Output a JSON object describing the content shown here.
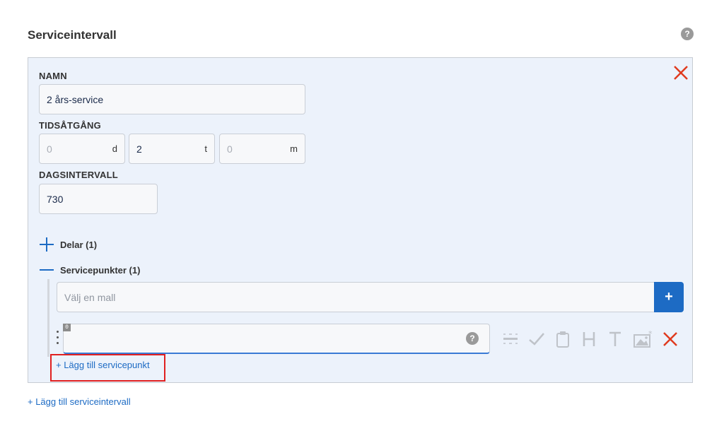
{
  "section": {
    "title": "Serviceintervall",
    "help_icon": "?"
  },
  "form": {
    "name": {
      "label": "NAMN",
      "value": "2 års-service"
    },
    "duration": {
      "label": "TIDSÅTGÅNG",
      "days": {
        "placeholder": "0",
        "unit": "d"
      },
      "hours": {
        "value": "2",
        "unit": "t"
      },
      "minutes": {
        "placeholder": "0",
        "unit": "m"
      }
    },
    "day_interval": {
      "label": "DAGSINTERVALL",
      "value": "730"
    }
  },
  "parts": {
    "label": "Delar (1)",
    "state": "collapsed"
  },
  "service_points": {
    "label": "Servicepunkter (1)",
    "state": "expanded",
    "template": {
      "placeholder": "Välj en mall",
      "add_label": "+"
    },
    "point": {
      "counter": "0",
      "value": "",
      "help_icon": "?"
    },
    "tools": [
      "divider-icon",
      "checkmark-icon",
      "clipboard-icon",
      "heading-icon",
      "text-icon",
      "image-icon",
      "delete-icon"
    ],
    "add_link": "+ Lägg till servicepunkt"
  },
  "add_interval_link": "+ Lägg till serviceintervall",
  "colors": {
    "accent": "#1d6bc4",
    "danger": "#e03a1e",
    "panel_bg": "#ecf2fb",
    "highlight": "#e02020"
  }
}
